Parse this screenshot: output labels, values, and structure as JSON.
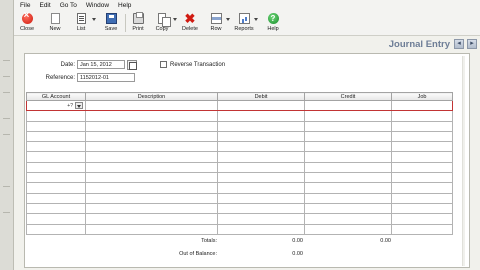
{
  "menu": [
    "File",
    "Edit",
    "Go To",
    "Window",
    "Help"
  ],
  "toolbar": {
    "close": "Close",
    "new": "New",
    "list": "List",
    "save": "Save",
    "print": "Print",
    "copy": "Copy",
    "delete": "Delete",
    "row": "Row",
    "reports": "Reports",
    "help": "Help"
  },
  "window": {
    "title": "Journal Entry"
  },
  "form": {
    "date_label": "Date:",
    "date_value": "Jan 15, 2012",
    "reference_label": "Reference:",
    "reference_value": "1152012-01",
    "reverse_label": "Reverse Transaction"
  },
  "grid": {
    "columns": [
      "GL Account",
      "Description",
      "Debit",
      "Credit",
      "Job"
    ],
    "rows": [
      {
        "gl_account": "",
        "description": "",
        "debit": "",
        "credit": "",
        "job": ""
      },
      {
        "gl_account": "",
        "description": "",
        "debit": "",
        "credit": "",
        "job": ""
      },
      {
        "gl_account": "",
        "description": "",
        "debit": "",
        "credit": "",
        "job": ""
      },
      {
        "gl_account": "",
        "description": "",
        "debit": "",
        "credit": "",
        "job": ""
      },
      {
        "gl_account": "",
        "description": "",
        "debit": "",
        "credit": "",
        "job": ""
      },
      {
        "gl_account": "",
        "description": "",
        "debit": "",
        "credit": "",
        "job": ""
      },
      {
        "gl_account": "",
        "description": "",
        "debit": "",
        "credit": "",
        "job": ""
      },
      {
        "gl_account": "",
        "description": "",
        "debit": "",
        "credit": "",
        "job": ""
      },
      {
        "gl_account": "",
        "description": "",
        "debit": "",
        "credit": "",
        "job": ""
      },
      {
        "gl_account": "",
        "description": "",
        "debit": "",
        "credit": "",
        "job": ""
      },
      {
        "gl_account": "",
        "description": "",
        "debit": "",
        "credit": "",
        "job": ""
      },
      {
        "gl_account": "",
        "description": "",
        "debit": "",
        "credit": "",
        "job": ""
      },
      {
        "gl_account": "",
        "description": "",
        "debit": "",
        "credit": "",
        "job": ""
      }
    ],
    "active_cell_control": "+?"
  },
  "totals": {
    "totals_label": "Totals:",
    "debit_total": "0.00",
    "credit_total": "0.00",
    "out_of_balance_label": "Out of Balance:",
    "out_of_balance_value": "0.00"
  },
  "colors": {
    "title": "#6d7d96",
    "active_row_border": "#c23434",
    "panel_bg": "#ffffff",
    "app_bg": "#f1f1ec"
  }
}
